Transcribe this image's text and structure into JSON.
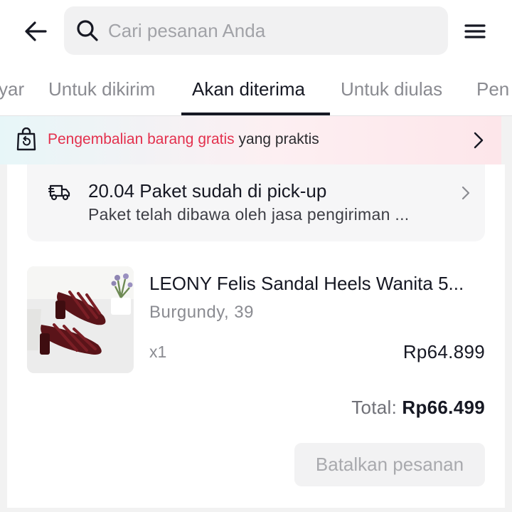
{
  "header": {
    "search": {
      "placeholder": "Cari pesanan Anda",
      "value": ""
    }
  },
  "tabs": [
    {
      "label": "yar",
      "active": false
    },
    {
      "label": "Untuk dikirim",
      "active": false
    },
    {
      "label": "Akan diterima",
      "active": true
    },
    {
      "label": "Untuk diulas",
      "active": false
    },
    {
      "label": "Pen",
      "active": false
    }
  ],
  "banner": {
    "highlight": "Pengembalian barang gratis",
    "text": " yang praktis",
    "highlight_color": "#e3304d"
  },
  "order": {
    "shipping": {
      "title": "20.04 Paket sudah di pick-up",
      "subtitle": "Paket telah dibawa oleh jasa pengiriman ..."
    },
    "product": {
      "name": "LEONY Felis Sandal Heels Wanita 5...",
      "variant": "Burgundy, 39",
      "quantity": "x1",
      "price": "Rp64.899"
    },
    "total": {
      "label": "Total:",
      "value": "Rp66.499"
    },
    "cancel_label": "Batalkan pesanan"
  },
  "icons": {
    "back": "arrow-left-icon",
    "search": "search-icon",
    "menu": "hamburger-menu-icon",
    "banner": "return-bag-icon",
    "shipping": "truck-icon",
    "chevron": "chevron-right-icon"
  }
}
